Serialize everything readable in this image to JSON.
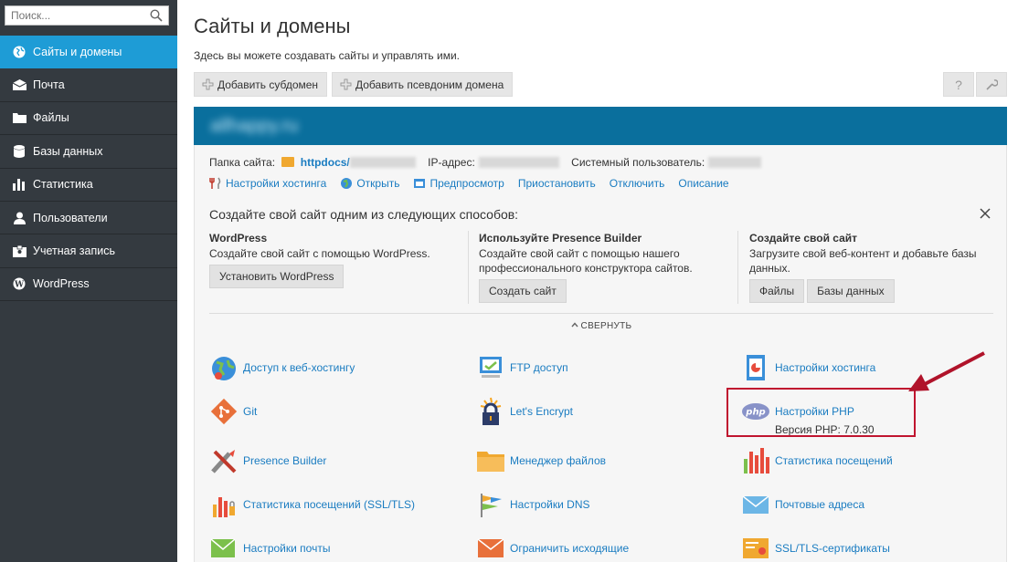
{
  "sidebar": {
    "search_placeholder": "Поиск...",
    "items": [
      {
        "label": "Сайты и домены",
        "icon": "globe-icon",
        "active": true
      },
      {
        "label": "Почта",
        "icon": "envelope-icon"
      },
      {
        "label": "Файлы",
        "icon": "folder-icon"
      },
      {
        "label": "Базы данных",
        "icon": "database-icon"
      },
      {
        "label": "Статистика",
        "icon": "bar-chart-icon"
      },
      {
        "label": "Пользователи",
        "icon": "user-icon"
      },
      {
        "label": "Учетная запись",
        "icon": "id-card-icon"
      },
      {
        "label": "WordPress",
        "icon": "wordpress-icon"
      }
    ]
  },
  "header": {
    "title": "Сайты и домены",
    "description": "Здесь вы можете создавать сайты и управлять ими.",
    "add_subdomain": "Добавить субдомен",
    "add_alias": "Добавить псевдоним домена",
    "help": "?"
  },
  "domain": {
    "name": "allhappy.ru",
    "folder_label": "Папка сайта:",
    "folder_value": "httpdocs/",
    "ip_label": "IP-адрес:",
    "sysuser_label": "Системный пользователь:",
    "actions": [
      "Настройки хостинга",
      "Открыть",
      "Предпросмотр",
      "Приостановить",
      "Отключить",
      "Описание"
    ]
  },
  "create": {
    "title": "Создайте свой сайт одним из следующих способов:",
    "columns": [
      {
        "title": "WordPress",
        "text": "Создайте свой сайт с помощью WordPress.",
        "buttons": [
          "Установить WordPress"
        ]
      },
      {
        "title": "Используйте Presence Builder",
        "text": "Создайте свой сайт с помощью нашего профессионального конструктора сайтов.",
        "buttons": [
          "Создать сайт"
        ]
      },
      {
        "title": "Создайте свой сайт",
        "text": "Загрузите свой веб-контент и добавьте базы данных.",
        "buttons": [
          "Файлы",
          "Базы данных"
        ]
      }
    ],
    "collapse": "СВЕРНУТЬ"
  },
  "tools": [
    {
      "label": "Доступ к веб-хостингу",
      "icon": "globe-key-icon"
    },
    {
      "label": "FTP доступ",
      "icon": "ftp-icon"
    },
    {
      "label": "Настройки хостинга",
      "icon": "hosting-settings-icon"
    },
    {
      "label": "Git",
      "icon": "git-icon"
    },
    {
      "label": "Let's Encrypt",
      "icon": "lets-encrypt-icon"
    },
    {
      "label": "Настройки PHP",
      "icon": "php-icon",
      "sub": "Версия PHP: 7.0.30"
    },
    {
      "label": "Presence Builder",
      "icon": "presence-builder-icon"
    },
    {
      "label": "Менеджер файлов",
      "icon": "file-manager-icon"
    },
    {
      "label": "Статистика посещений",
      "icon": "visit-stats-icon"
    },
    {
      "label": "Статистика посещений (SSL/TLS)",
      "icon": "ssl-stats-icon"
    },
    {
      "label": "Настройки DNS",
      "icon": "dns-icon"
    },
    {
      "label": "Почтовые адреса",
      "icon": "mail-addresses-icon"
    },
    {
      "label": "Настройки почты",
      "icon": "mail-settings-icon"
    },
    {
      "label": "Ограничить исходящие",
      "icon": "limit-outgoing-icon"
    },
    {
      "label": "SSL/TLS-сертификаты",
      "icon": "certificate-icon"
    }
  ],
  "colors": {
    "sidebar": "#343a40",
    "active": "#1e9cd6",
    "domain_header": "#0a6f9d",
    "link": "#1a7cc1",
    "highlight": "#c0152f"
  }
}
